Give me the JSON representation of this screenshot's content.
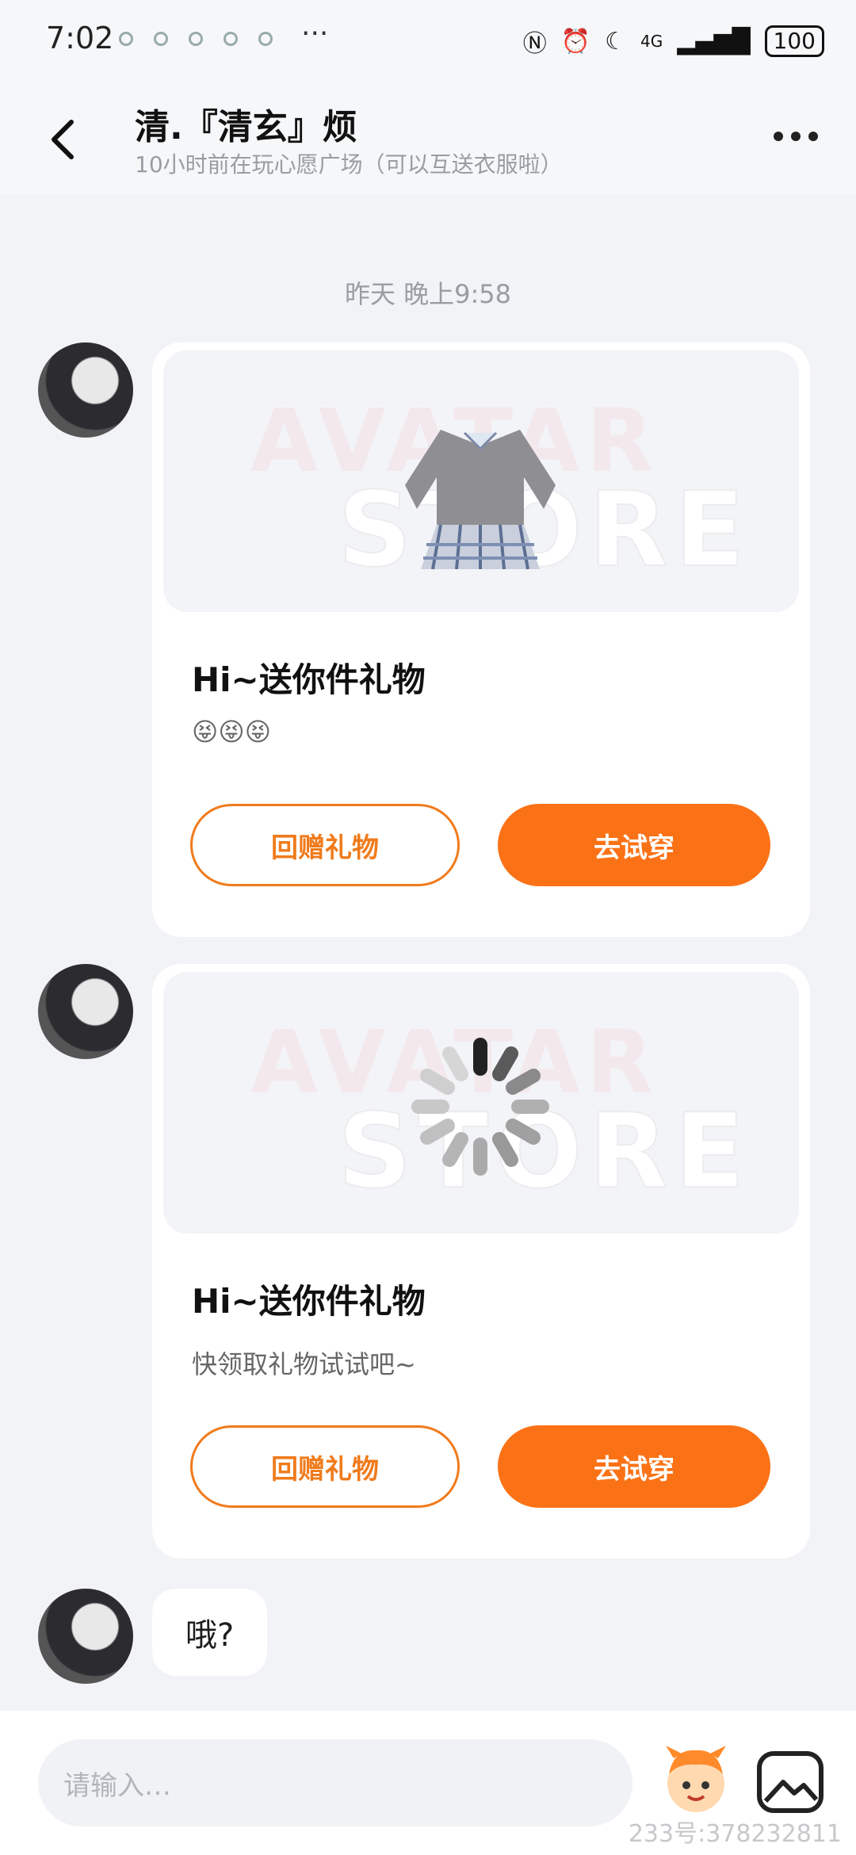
{
  "status_bar": {
    "time": "7:02",
    "more": "···",
    "network": "4G",
    "battery": "100"
  },
  "header": {
    "title": "清.『清玄』烦",
    "subtitle": "10小时前在玩心愿广场（可以互送衣服啦）"
  },
  "chat": {
    "timestamp": "昨天 晚上9:58",
    "messages": [
      {
        "type": "gift",
        "title": "Hi~送你件礼物",
        "text": "😝😝😝",
        "image": "sweater-skirt-outfit",
        "watermark_top": "AVATAR",
        "watermark_bottom": "STORE",
        "return_gift_label": "回赠礼物",
        "try_on_label": "去试穿"
      },
      {
        "type": "gift",
        "title": "Hi~送你件礼物",
        "text": "快领取礼物试试吧~",
        "image": "loading-spinner",
        "watermark_top": "AVATAR",
        "watermark_bottom": "STORE",
        "return_gift_label": "回赠礼物",
        "try_on_label": "去试穿"
      },
      {
        "type": "text",
        "text": "哦?"
      }
    ]
  },
  "input": {
    "placeholder": "请输入…",
    "footer_watermark": "233号:378232811"
  },
  "colors": {
    "accent": "#fb7216",
    "background": "#f2f3f6"
  }
}
